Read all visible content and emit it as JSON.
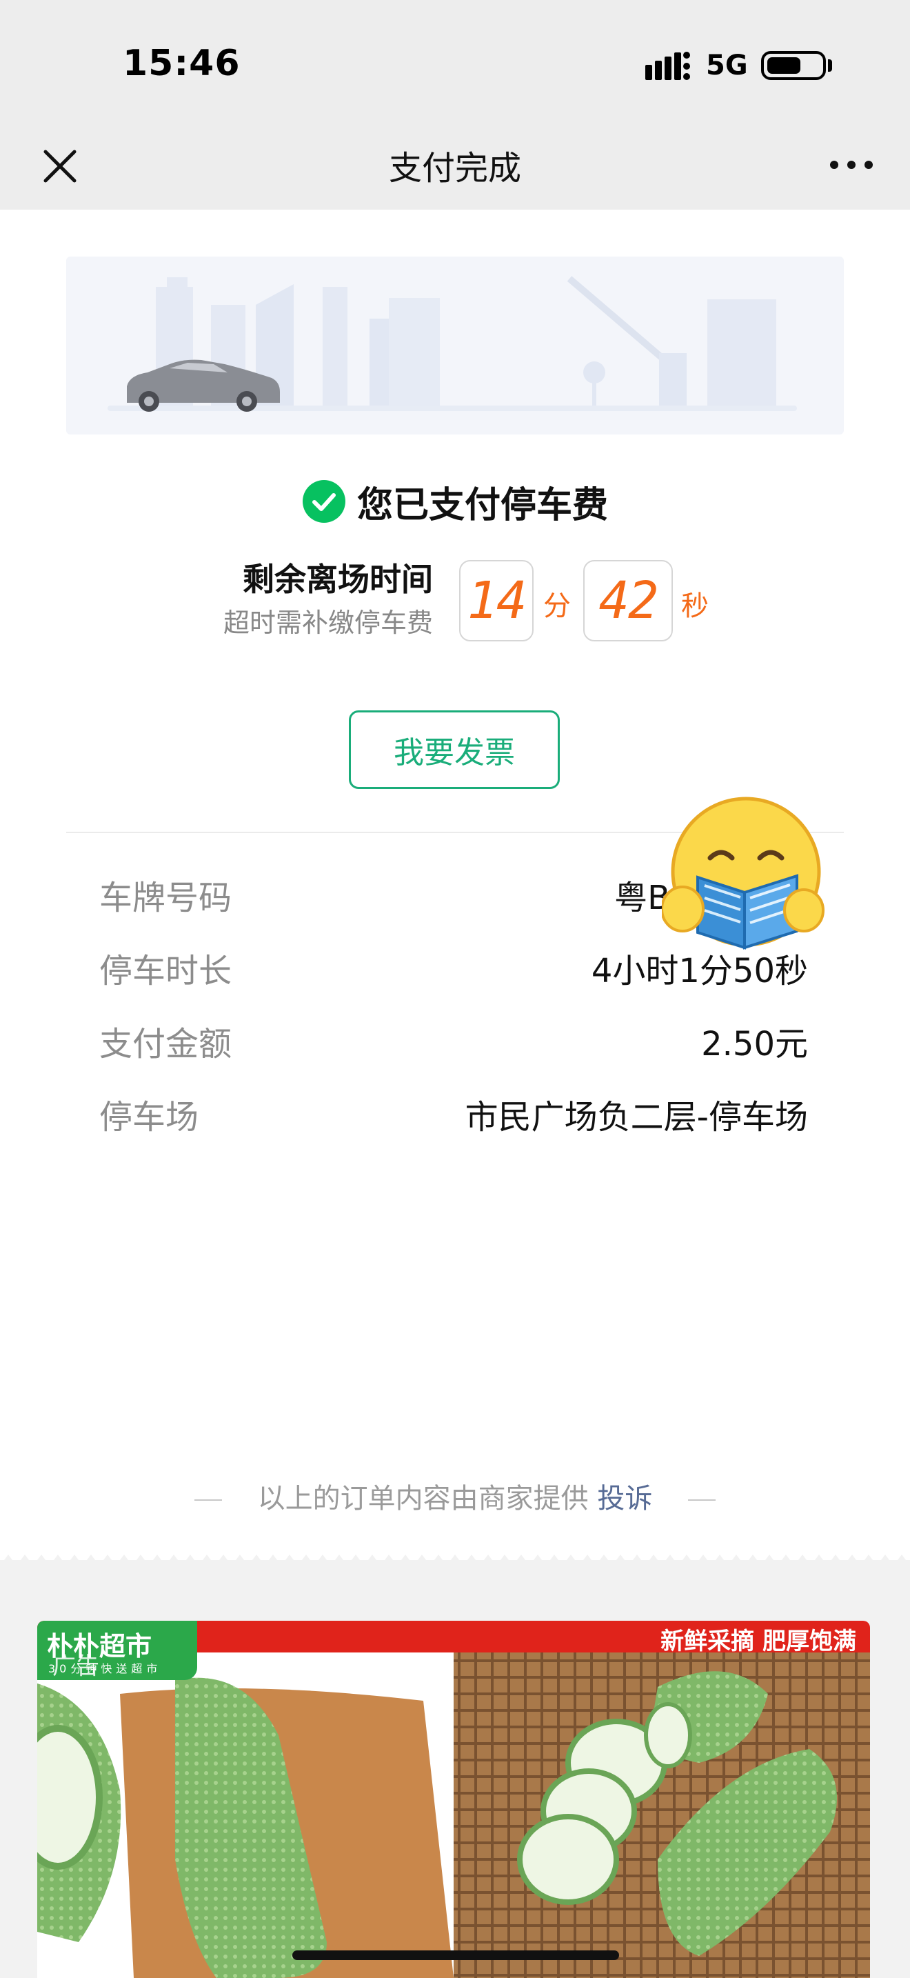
{
  "status_bar": {
    "time": "15:46",
    "network": "5G"
  },
  "nav": {
    "title": "支付完成"
  },
  "payment": {
    "status_text": "您已支付停车费",
    "remain_label": "剩余离场时间",
    "remain_sub": "超时需补缴停车费",
    "minutes": "14",
    "minutes_unit": "分",
    "seconds": "42",
    "seconds_unit": "秒",
    "invoice_button": "我要发票"
  },
  "details": [
    {
      "label": "车牌号码",
      "value": "粤B"
    },
    {
      "label": "停车时长",
      "value": "4小时1分50秒"
    },
    {
      "label": "支付金额",
      "value": "2.50元"
    },
    {
      "label": "停车场",
      "value": "市民广场负二层-停车场"
    }
  ],
  "footer": {
    "note": "以上的订单内容由商家提供",
    "complain": "投诉"
  },
  "ad": {
    "brand": "朴朴超市",
    "brand_sub": "30分钟快送超市",
    "tag": "广告",
    "slogan": "新鲜采摘  肥厚饱满"
  },
  "colors": {
    "accent": "#1aad7a",
    "countdown": "#f46a18",
    "link": "#576b95",
    "ad_red": "#e0231b",
    "ad_green": "#2ba84a"
  }
}
